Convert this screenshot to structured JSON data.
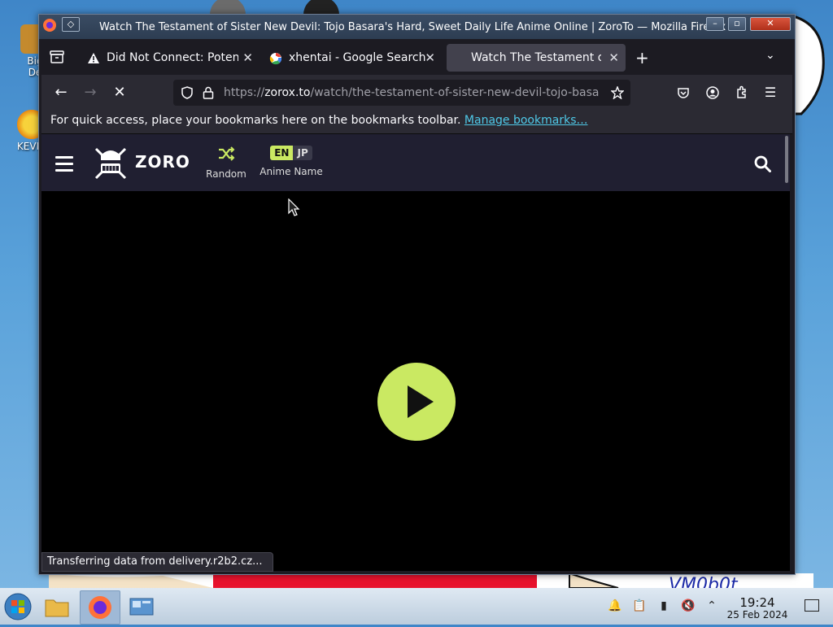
{
  "desktop": {
    "icons": [
      {
        "label": "Big\nDe"
      },
      {
        "label": "KEVIN"
      }
    ],
    "wallpaper_text": "VM0b0t"
  },
  "window": {
    "title": "Watch The Testament of Sister New Devil: Tojo Basara's Hard, Sweet Daily Life Anime Online | ZoroTo — Mozilla Firefox"
  },
  "tabs": [
    {
      "label": "Did Not Connect: Potenti",
      "icon": "warning-icon",
      "active": false
    },
    {
      "label": "xhentai - Google Search",
      "icon": "google-icon",
      "active": false
    },
    {
      "label": "Watch The Testament of",
      "icon": "loading-icon",
      "active": true
    }
  ],
  "navbar": {
    "url_domain": "zorox.to",
    "url_prefix": "https://",
    "url_path": "/watch/the-testament-of-sister-new-devil-tojo-basara"
  },
  "bookmarks_bar": {
    "text": "For quick access, place your bookmarks here on the bookmarks toolbar.",
    "link": "Manage bookmarks…"
  },
  "site": {
    "logo": "ZORO",
    "random_label": "Random",
    "lang_en": "EN",
    "lang_jp": "JP",
    "anime_name_label": "Anime Name"
  },
  "status_text": "Transferring data from delivery.r2b2.cz...",
  "taskbar": {
    "time": "19:24",
    "date": "25 Feb 2024"
  },
  "colors": {
    "accent": "#cae962",
    "site_header": "#201f31",
    "link": "#4fc9e8"
  }
}
